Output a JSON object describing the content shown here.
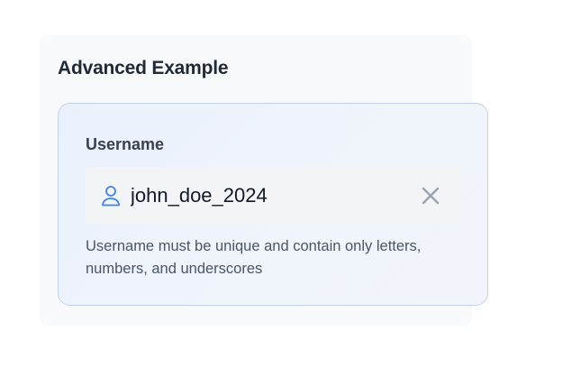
{
  "section": {
    "title": "Advanced Example"
  },
  "field": {
    "label": "Username",
    "value": "john_doe_2024",
    "leading_icon": "user-icon",
    "trailing_icon": "close-icon",
    "helper_text": "Username must be unique and contain only letters, numbers, and underscores"
  },
  "colors": {
    "accent": "#3b82f6",
    "clear_icon": "#9ca3af",
    "inner_border": "#bfd3ee"
  }
}
